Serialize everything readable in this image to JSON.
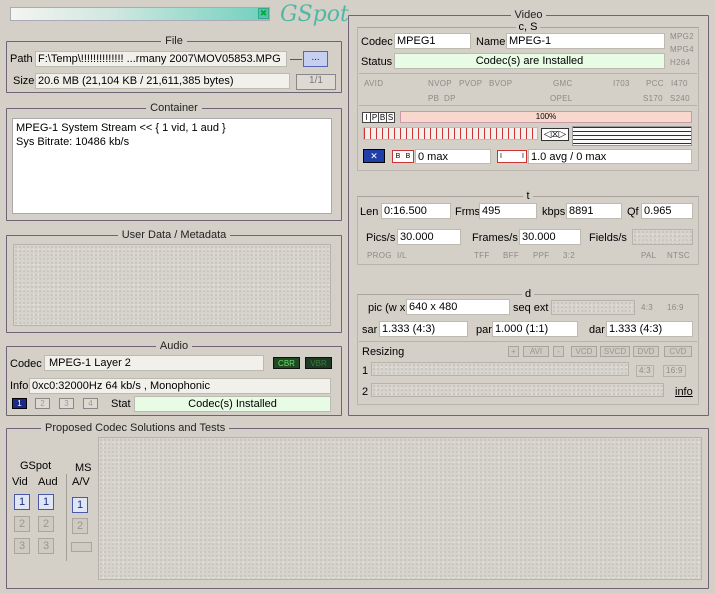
{
  "logo": {
    "text": "GSpot",
    "grid_icon": "toolbar-grid-icon"
  },
  "file": {
    "title": "File",
    "path_label": "Path",
    "path_value": "F:\\Temp\\!!!!!!!!!!!!!! ...rmany 2007\\MOV05853.MPG",
    "browse_label": "...",
    "size_label": "Size",
    "size_value": "20.6 MB (21,104 KB / 21,611,385 bytes)",
    "page_counter": "1/1"
  },
  "container": {
    "title": "Container",
    "lines": [
      "MPEG-1 System Stream << { 1 vid, 1 aud }",
      "Sys Bitrate: 10486 kb/s"
    ]
  },
  "userdata": {
    "title": "User Data / Metadata"
  },
  "audio": {
    "title": "Audio",
    "codec_label": "Codec",
    "codec_value": "MPEG-1 Layer 2",
    "cbr": "CBR",
    "vbr": "VBR",
    "info_label": "Info",
    "info_value": "0xc0:32000Hz  64 kb/s , Monophonic",
    "streams": [
      "1",
      "2",
      "3",
      "4"
    ],
    "stat_label": "Stat",
    "stat_value": "Codec(s) Installed"
  },
  "video": {
    "title": "Video",
    "cs_title": "c, S",
    "codec_label": "Codec",
    "codec_value": "MPEG1",
    "name_label": "Name",
    "name_value": "MPEG-1",
    "status_label": "Status",
    "status_value": "Codec(s) are Installed",
    "side_tags": [
      "MPG2",
      "MPG4",
      "H264"
    ],
    "flags": [
      "AVID",
      "NVOP",
      "PVOP",
      "BVOP",
      "GMC",
      "I703",
      "PCC",
      "I470",
      "PB",
      "DP",
      "OPEL",
      "S170",
      "S240"
    ],
    "ipbs": [
      "I",
      "P",
      "B",
      "S"
    ],
    "gop_pct": "100%",
    "bframes_value": "0 max",
    "bframes_marks": [
      "B",
      "B"
    ],
    "iframes_value": "1.0 avg / 0 max",
    "iframes_marks": [
      "I",
      "I"
    ],
    "t": {
      "title": "t",
      "len_label": "Len",
      "len_value": "0:16.500",
      "frms_label": "Frms",
      "frms_value": "495",
      "kbps_label": "kbps",
      "kbps_value": "8891",
      "qf_label": "Qf",
      "qf_value": "0.965",
      "pics_label": "Pics/s",
      "pics_value": "30.000",
      "frames_label": "Frames/s",
      "frames_value": "30.000",
      "fields_label": "Fields/s",
      "fields_value": "",
      "tags": [
        "PROG",
        "I/L",
        "TFF",
        "BFF",
        "PPF",
        "3:2",
        "PAL",
        "NTSC"
      ]
    },
    "d": {
      "title": "d",
      "pic_label": "pic (w x h)",
      "pic_value": "640 x 480",
      "seq_label": "seq ext",
      "ratio_tags": [
        "4:3",
        "16:9"
      ],
      "sar_label": "sar",
      "sar_value": "1.333 (4:3)",
      "par_label": "par",
      "par_value": "1.000 (1:1)",
      "dar_label": "dar",
      "dar_value": "1.333 (4:3)"
    },
    "resizing": {
      "label": "Resizing",
      "buttons": [
        "+",
        "AVI",
        "-",
        "VCD",
        "SVCD",
        "DVD",
        "CVD"
      ],
      "row1": "1",
      "row2": "2",
      "ratio1": "4:3",
      "ratio2": "16:9",
      "info_link": "info"
    }
  },
  "codec_solutions": {
    "title": "Proposed Codec Solutions and Tests",
    "gspot_label": "GSpot",
    "vid_label": "Vid",
    "aud_label": "Aud",
    "ms_label": "MS",
    "av_label": "A/V",
    "numbers": [
      "1",
      "2",
      "3"
    ]
  }
}
